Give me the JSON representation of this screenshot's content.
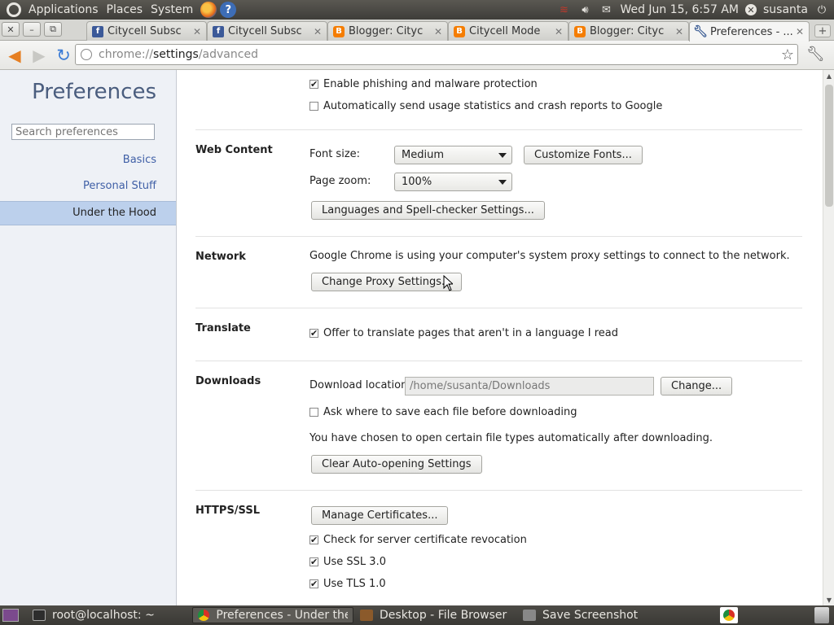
{
  "top_panel": {
    "menus": [
      "Applications",
      "Places",
      "System"
    ],
    "datetime": "Wed Jun 15,  6:57 AM",
    "user": "susanta"
  },
  "tabs": [
    {
      "label": "Citycell Subsc",
      "favicon": "facebook-icon"
    },
    {
      "label": "Citycell Subsc",
      "favicon": "facebook-icon"
    },
    {
      "label": "Blogger: Cityc",
      "favicon": "blogger-icon"
    },
    {
      "label": "Citycell Mode",
      "favicon": "blogger-icon"
    },
    {
      "label": "Blogger: Cityc",
      "favicon": "blogger-icon"
    },
    {
      "label": "Preferences - ...",
      "favicon": "wrench-icon",
      "active": true
    }
  ],
  "toolbar": {
    "url_scheme": "chrome://",
    "url_host": "settings",
    "url_path": "/advanced"
  },
  "sidebar": {
    "title": "Preferences",
    "search_placeholder": "Search preferences",
    "items": [
      {
        "label": "Basics"
      },
      {
        "label": "Personal Stuff"
      },
      {
        "label": "Under the Hood",
        "active": true
      }
    ]
  },
  "privacy": {
    "phishing": {
      "label": "Enable phishing and malware protection",
      "checked": true
    },
    "usage_stats": {
      "label": "Automatically send usage statistics and crash reports to Google",
      "checked": false
    }
  },
  "web_content": {
    "section": "Web Content",
    "font_size_label": "Font size:",
    "font_size_value": "Medium",
    "customize_fonts_button": "Customize Fonts...",
    "page_zoom_label": "Page zoom:",
    "page_zoom_value": "100%",
    "languages_button": "Languages and Spell-checker Settings..."
  },
  "network": {
    "section": "Network",
    "description": "Google Chrome is using your computer's system proxy settings to connect to the network.",
    "proxy_button": "Change Proxy Settings..."
  },
  "translate": {
    "section": "Translate",
    "offer": {
      "label": "Offer to translate pages that aren't in a language I read",
      "checked": true
    }
  },
  "downloads": {
    "section": "Downloads",
    "location_label": "Download location:",
    "location_value": "/home/susanta/Downloads",
    "change_button": "Change...",
    "ask_where": {
      "label": "Ask where to save each file before downloading",
      "checked": false
    },
    "auto_open_text": "You have chosen to open certain file types automatically after downloading.",
    "clear_button": "Clear Auto-opening Settings"
  },
  "https": {
    "section": "HTTPS/SSL",
    "certs_button": "Manage Certificates...",
    "revocation": {
      "label": "Check for server certificate revocation",
      "checked": true
    },
    "ssl3": {
      "label": "Use SSL 3.0",
      "checked": true
    },
    "tls1": {
      "label": "Use TLS 1.0",
      "checked": true
    }
  },
  "taskbar": {
    "tasks": [
      {
        "label": "root@localhost: ~"
      },
      {
        "label": "Preferences - Under the..."
      },
      {
        "label": "Desktop - File Browser"
      },
      {
        "label": "Save Screenshot"
      }
    ]
  },
  "check_mark": "✔"
}
